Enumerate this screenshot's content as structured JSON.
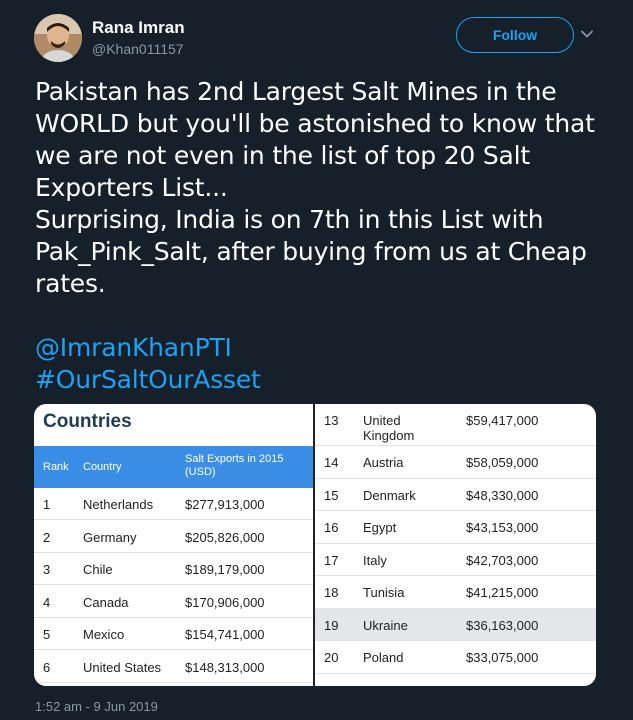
{
  "user": {
    "name": "Rana Imran",
    "handle": "@Khan011157"
  },
  "follow_label": "Follow",
  "tweet": {
    "lines": [
      "Pakistan has 2nd Largest Salt Mines in the",
      "WORLD but you'll be astonished to know that",
      "we are not even in the list of top 20 Salt",
      "Exporters List...",
      "Surprising, India is on 7th in this List with",
      "Pak_Pink_Salt, after buying from us at Cheap",
      "rates."
    ],
    "mention": "@ImranKhanPTI",
    "hashtag": "#OurSaltOurAsset"
  },
  "media": {
    "title": "Countries",
    "headers": {
      "rank": "Rank",
      "country": "Country",
      "exports": "Salt Exports in 2015 (USD)"
    },
    "left_rows": [
      {
        "rank": "1",
        "country": "Netherlands",
        "value": "$277,913,000"
      },
      {
        "rank": "2",
        "country": "Germany",
        "value": "$205,826,000"
      },
      {
        "rank": "3",
        "country": "Chile",
        "value": "$189,179,000"
      },
      {
        "rank": "4",
        "country": "Canada",
        "value": "$170,906,000"
      },
      {
        "rank": "5",
        "country": "Mexico",
        "value": "$154,741,000"
      },
      {
        "rank": "6",
        "country": "United States",
        "value": "$148,313,000"
      }
    ],
    "right_rows": [
      {
        "rank": "13",
        "country": "United Kingdom",
        "value": "$59,417,000"
      },
      {
        "rank": "14",
        "country": "Austria",
        "value": "$58,059,000"
      },
      {
        "rank": "15",
        "country": "Denmark",
        "value": "$48,330,000"
      },
      {
        "rank": "16",
        "country": "Egypt",
        "value": "$43,153,000"
      },
      {
        "rank": "17",
        "country": "Italy",
        "value": "$42,703,000"
      },
      {
        "rank": "18",
        "country": "Tunisia",
        "value": "$41,215,000"
      },
      {
        "rank": "19",
        "country": "Ukraine",
        "value": "$36,163,000"
      },
      {
        "rank": "20",
        "country": "Poland",
        "value": "$33,075,000"
      }
    ]
  },
  "timestamp": "1:52 am - 9 Jun 2019",
  "colors": {
    "background": "#15202b",
    "accent": "#1da1f2",
    "table_header": "#3a8ee6",
    "muted": "#8899a6"
  }
}
